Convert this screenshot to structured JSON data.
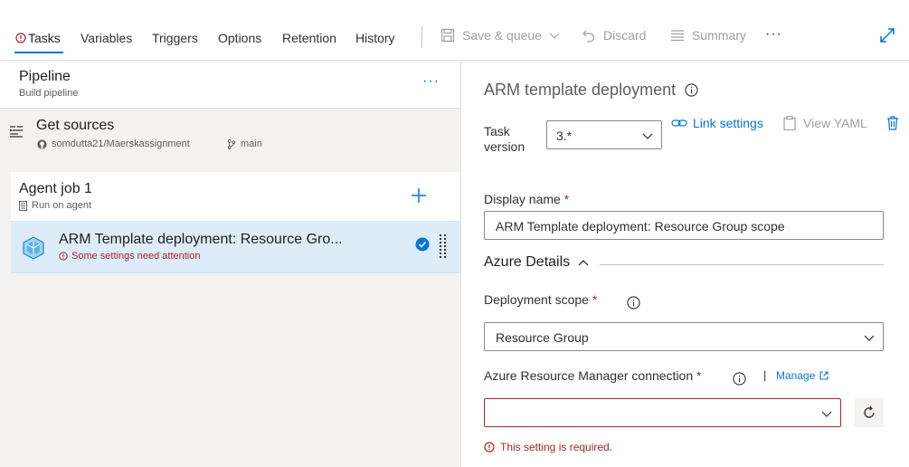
{
  "tabs": [
    {
      "label": "Tasks",
      "active": true,
      "has_error": true
    },
    {
      "label": "Variables"
    },
    {
      "label": "Triggers"
    },
    {
      "label": "Options"
    },
    {
      "label": "Retention"
    },
    {
      "label": "History"
    }
  ],
  "toolbar": {
    "save_queue_label": "Save & queue",
    "discard_label": "Discard",
    "summary_label": "Summary",
    "more_label": "···"
  },
  "pipeline": {
    "title": "Pipeline",
    "subtitle": "Build pipeline",
    "more_label": "···"
  },
  "get_sources": {
    "title": "Get sources",
    "repo": "somdutta21/Maerskassignment",
    "branch": "main"
  },
  "agent_job": {
    "title": "Agent job 1",
    "subtitle": "Run on agent"
  },
  "task": {
    "title": "ARM Template deployment: Resource Gro...",
    "warning": "Some settings need attention"
  },
  "details": {
    "title": "ARM template deployment",
    "task_version_label_1": "Task",
    "task_version_label_2": "version",
    "task_version_value": "3.*",
    "link_settings_label": "Link settings",
    "view_yaml_label": "View YAML",
    "display_name_label": "Display name",
    "required_mark": "*",
    "display_name_value": "ARM Template deployment: Resource Group scope",
    "section_title": "Azure Details",
    "deployment_scope_label": "Deployment scope",
    "deployment_scope_value": "Resource Group",
    "connection_label": "Azure Resource Manager connection",
    "separator": "|",
    "manage_label": "Manage",
    "connection_value": "",
    "error_text": "This setting is required."
  },
  "colors": {
    "accent": "#0078d4",
    "error": "#a4262c",
    "selected_row": "#deecf9"
  }
}
